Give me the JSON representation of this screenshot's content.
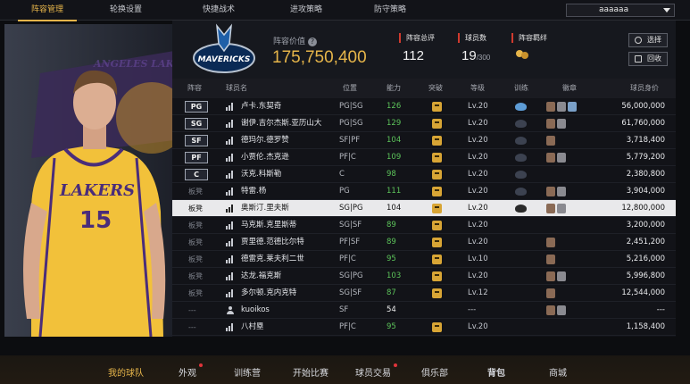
{
  "top_tabs": [
    {
      "label": "阵容管理",
      "active": true
    },
    {
      "label": "轮换设置",
      "active": false
    },
    {
      "label": "快捷战术",
      "active": false
    },
    {
      "label": "进攻策略",
      "active": false
    },
    {
      "label": "防守策略",
      "active": false
    }
  ],
  "user_select": {
    "value": "aaaaaa"
  },
  "team": {
    "logo_text": "MAVERICKS",
    "value_label": "阵容价值",
    "value": "175,750,400",
    "total_rating_label": "阵容总评",
    "total_rating": "112",
    "player_count_label": "球员数",
    "player_count": "19",
    "player_count_max": "/300",
    "bonds_label": "阵容羁绊"
  },
  "buttons": {
    "select": "选择",
    "recycle": "回收"
  },
  "columns": {
    "lineup": "阵容",
    "name": "球员名",
    "position": "位置",
    "rating": "能力",
    "breakthrough": "突破",
    "level": "等级",
    "training": "训练",
    "badges": "徽章",
    "salary": "球员身价"
  },
  "rows": [
    {
      "slot": "PG",
      "starter": true,
      "name": "卢卡.东契奇",
      "position": "PG|SG",
      "rating": "126",
      "level": "Lv.20",
      "train": "blue",
      "badges": [
        "#8a6a55",
        "#8a8a90",
        "#7aa0c8"
      ],
      "salary": "56,000,000"
    },
    {
      "slot": "SG",
      "starter": true,
      "name": "谢伊.吉尔杰斯.亚历山大",
      "position": "PG|SG",
      "rating": "129",
      "level": "Lv.20",
      "train": "dark",
      "badges": [
        "#8a6a55",
        "#8a8a90"
      ],
      "salary": "61,760,000"
    },
    {
      "slot": "SF",
      "starter": true,
      "name": "德玛尔.德罗赞",
      "position": "SF|PF",
      "rating": "104",
      "level": "Lv.20",
      "train": "dark",
      "badges": [
        "#8a6a55"
      ],
      "salary": "3,718,400"
    },
    {
      "slot": "PF",
      "starter": true,
      "name": "小贾伦.杰克逊",
      "position": "PF|C",
      "rating": "109",
      "level": "Lv.20",
      "train": "dark",
      "badges": [
        "#8a6a55",
        "#8a8a90"
      ],
      "salary": "5,779,200"
    },
    {
      "slot": "C",
      "starter": true,
      "name": "沃克.科斯勒",
      "position": "C",
      "rating": "98",
      "level": "Lv.20",
      "train": "dark",
      "badges": [],
      "salary": "2,380,800"
    },
    {
      "slot": "板凳",
      "starter": false,
      "name": "特雷.杨",
      "position": "PG",
      "rating": "111",
      "level": "Lv.20",
      "train": "dark",
      "badges": [
        "#8a6a55",
        "#8a8a90"
      ],
      "salary": "3,904,000"
    },
    {
      "slot": "板凳",
      "starter": false,
      "highlight": true,
      "name": "奥斯汀.里夫斯",
      "position": "SG|PG",
      "rating": "104",
      "level": "Lv.20",
      "train": "dark",
      "badges": [
        "#8a6a55",
        "#8a8a90"
      ],
      "salary": "12,800,000"
    },
    {
      "slot": "板凳",
      "starter": false,
      "name": "马克斯.克里斯蒂",
      "position": "SG|SF",
      "rating": "89",
      "level": "Lv.20",
      "train": "none",
      "badges": [],
      "salary": "3,200,000"
    },
    {
      "slot": "板凳",
      "starter": false,
      "name": "贾里德.范德比尔特",
      "position": "PF|SF",
      "rating": "89",
      "level": "Lv.20",
      "train": "none",
      "badges": [
        "#8a6a55"
      ],
      "salary": "2,451,200"
    },
    {
      "slot": "板凳",
      "starter": false,
      "name": "德雷克.莱夫利二世",
      "position": "PF|C",
      "rating": "95",
      "level": "Lv.10",
      "train": "none",
      "badges": [
        "#8a6a55"
      ],
      "salary": "5,216,000"
    },
    {
      "slot": "板凳",
      "starter": false,
      "name": "达龙.福克斯",
      "position": "SG|PG",
      "rating": "103",
      "level": "Lv.20",
      "train": "none",
      "badges": [
        "#8a6a55",
        "#8a8a90"
      ],
      "salary": "5,996,800"
    },
    {
      "slot": "板凳",
      "starter": false,
      "name": "多尔顿.克内克特",
      "position": "SG|SF",
      "rating": "87",
      "level": "Lv.12",
      "train": "none",
      "badges": [
        "#8a6a55"
      ],
      "salary": "12,544,000"
    },
    {
      "slot": "---",
      "starter": false,
      "person": true,
      "name": "kuoikos",
      "position": "SF",
      "rating": "54",
      "rating_white": true,
      "level": "---",
      "train": "none",
      "badges": [
        "#8a6a55",
        "#8a8a90"
      ],
      "salary": "---",
      "no_break": true
    },
    {
      "slot": "---",
      "starter": false,
      "name": "八村塁",
      "position": "PF|C",
      "rating": "95",
      "level": "Lv.20",
      "train": "none",
      "badges": [],
      "salary": "1,158,400"
    }
  ],
  "bottom_nav": [
    {
      "label": "我的球队",
      "active": true,
      "dot": false
    },
    {
      "label": "外观",
      "active": false,
      "dot": true
    },
    {
      "label": "训练营",
      "active": false,
      "dot": false
    },
    {
      "label": "开始比赛",
      "active": false,
      "dot": false
    },
    {
      "label": "球员交易",
      "active": false,
      "dot": true
    },
    {
      "label": "俱乐部",
      "active": false,
      "dot": false
    },
    {
      "label": "背包",
      "active": false,
      "dot": false
    },
    {
      "label": "商城",
      "active": false,
      "dot": false
    }
  ],
  "art": {
    "jersey_team": "LAKERS",
    "jersey_number": "15",
    "wall_text": "ANGELES LAKERS"
  },
  "colors": {
    "accent": "#e6b54a",
    "rating_green": "#5cc35a",
    "stat_red": "#d03a2e"
  }
}
